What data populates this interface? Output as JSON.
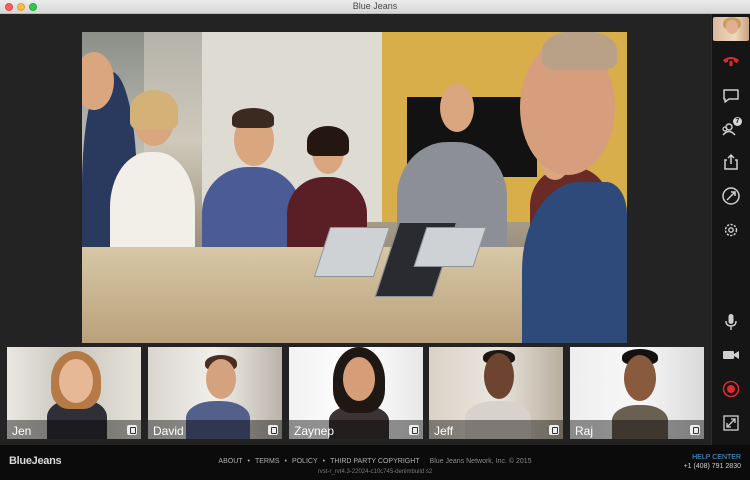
{
  "window": {
    "title": "Blue Jeans"
  },
  "sidebar": {
    "chat_badge_count": "7",
    "hangup_color": "#e0282e",
    "record_color": "#e0282e",
    "icon_color": "#cfcfcf",
    "buttons": [
      {
        "name": "hangup-icon"
      },
      {
        "name": "chat-icon"
      },
      {
        "name": "participants-icon"
      },
      {
        "name": "share-screen-icon"
      },
      {
        "name": "connection-icon"
      },
      {
        "name": "settings-icon"
      },
      {
        "name": "microphone-icon"
      },
      {
        "name": "camera-icon"
      },
      {
        "name": "record-icon"
      },
      {
        "name": "fullscreen-icon"
      }
    ]
  },
  "participants": [
    {
      "name": "Jen"
    },
    {
      "name": "David"
    },
    {
      "name": "Zaynep"
    },
    {
      "name": "Jeff"
    },
    {
      "name": "Raj"
    }
  ],
  "footer": {
    "brand": "BlueJeans",
    "links": [
      "ABOUT",
      "TERMS",
      "POLICY",
      "THIRD PARTY COPYRIGHT"
    ],
    "copyright": "Blue Jeans Network, Inc. © 2015",
    "build": "rvst-r_rvt4.3-22024-c10c745-denimbuild s2",
    "help_center": "HELP CENTER",
    "phone": "+1 (408) 791 2830"
  }
}
